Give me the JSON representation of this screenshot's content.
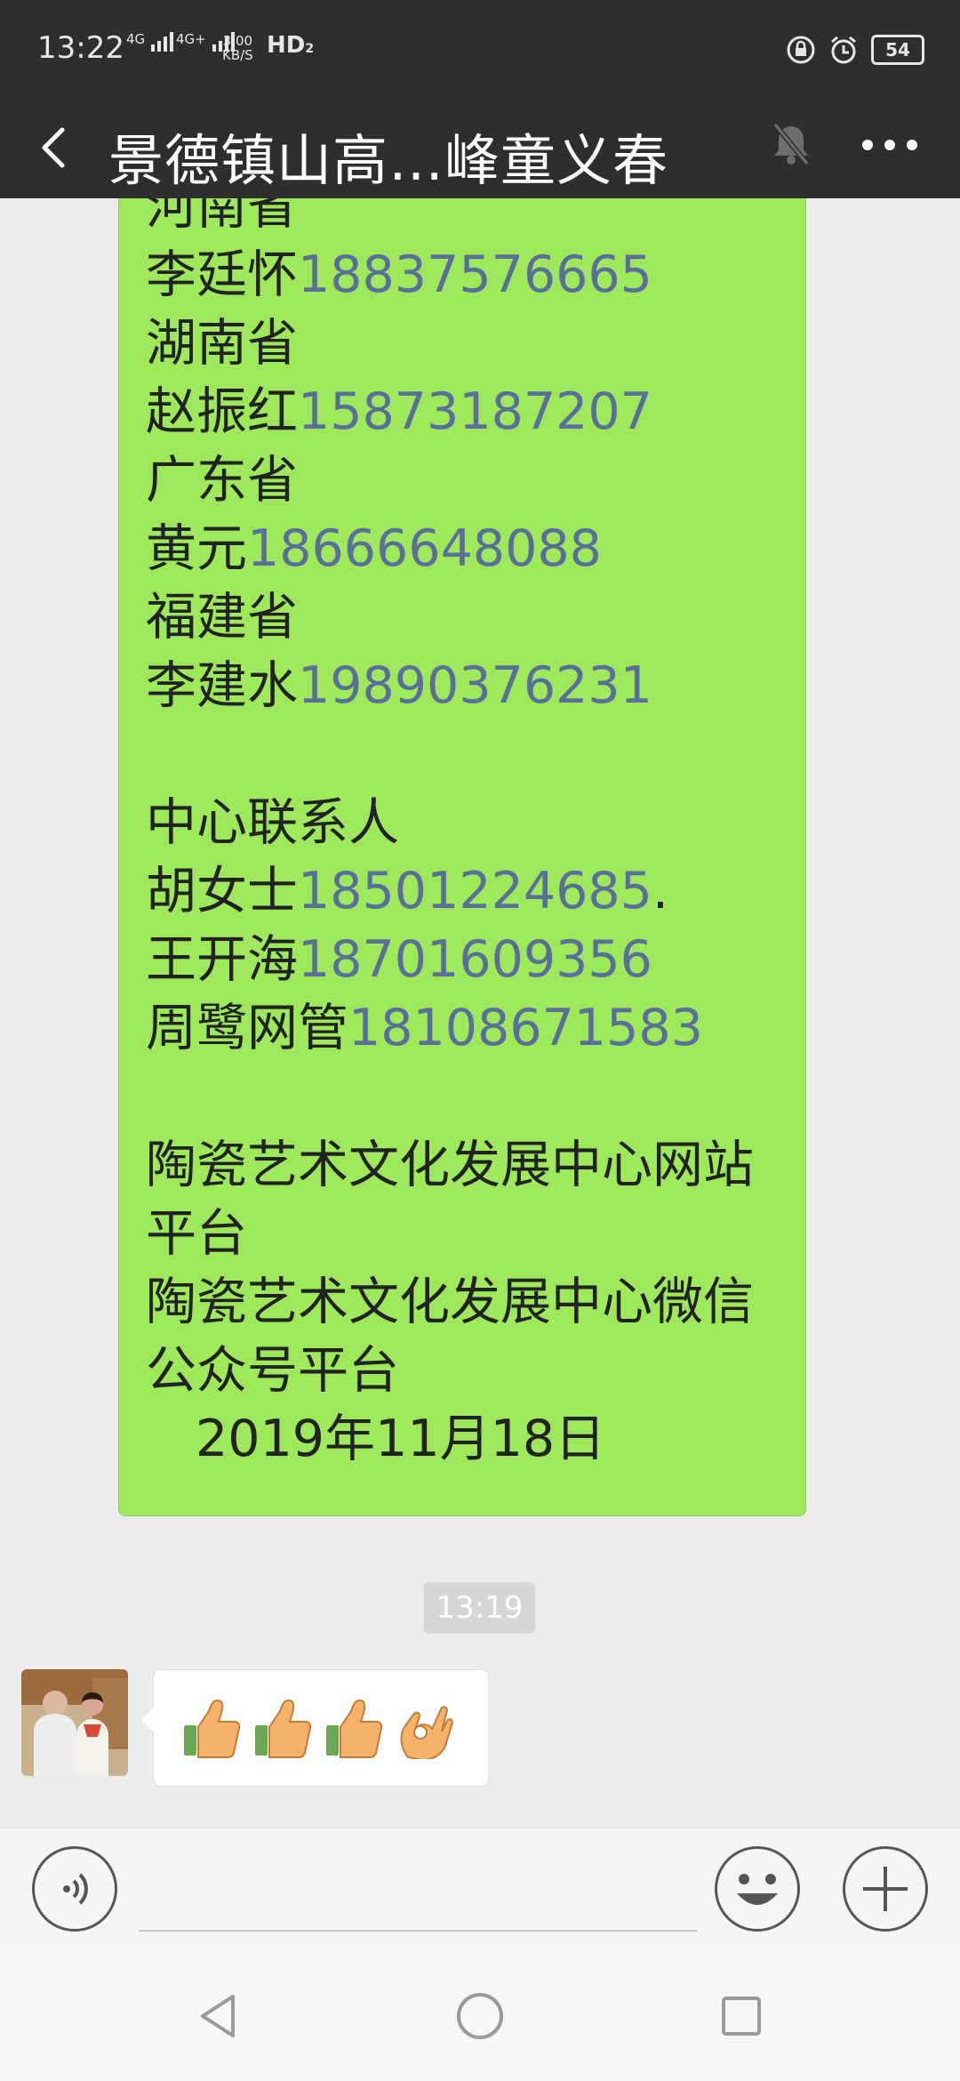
{
  "status_bar": {
    "time": "13:22",
    "network_1": "4G",
    "network_2": "4G+",
    "speed_value": "3.00",
    "speed_unit": "KB/S",
    "hd_label": "HD",
    "hd_sub": "2",
    "battery": "54"
  },
  "header": {
    "title": "景德镇山高…峰童义春",
    "back_icon": "chevron-left-icon",
    "mute_icon": "bell-muted-icon",
    "more_icon": "ellipsis-icon"
  },
  "message": {
    "lines": [
      {
        "text": "河南省",
        "phone": ""
      },
      {
        "text": "李廷怀",
        "phone": "18837576665"
      },
      {
        "text": "湖南省",
        "phone": ""
      },
      {
        "text": "赵振红",
        "phone": "15873187207"
      },
      {
        "text": "广东省",
        "phone": ""
      },
      {
        "text": "黄元",
        "phone": "18666648088"
      },
      {
        "text": "福建省",
        "phone": ""
      },
      {
        "text": "李建水",
        "phone": "19890376231"
      },
      {
        "text": "",
        "phone": ""
      },
      {
        "text": "中心联系人",
        "phone": ""
      },
      {
        "text": "胡女士",
        "phone": "18501224685",
        "suffix": "."
      },
      {
        "text": "王开海",
        "phone": "18701609356"
      },
      {
        "text": "周鹭网管",
        "phone": "18108671583"
      },
      {
        "text": "",
        "phone": ""
      },
      {
        "text": "陶瓷艺术文化发展中心网站",
        "phone": ""
      },
      {
        "text": "平台",
        "phone": ""
      },
      {
        "text": "陶瓷艺术文化发展中心微信",
        "phone": ""
      },
      {
        "text": "公众号平台",
        "phone": ""
      },
      {
        "text": "2019年11月18日",
        "phone": "",
        "indent": true
      }
    ]
  },
  "timestamp": "13:19",
  "reply": {
    "emojis": [
      "thumbs-up-icon",
      "thumbs-up-icon",
      "thumbs-up-icon",
      "ok-hand-icon"
    ]
  },
  "input_bar": {
    "voice_icon": "voice-icon",
    "emoji_icon": "smiley-icon",
    "plus_icon": "plus-icon",
    "text_value": ""
  },
  "colors": {
    "header_bg": "#2e2e2e",
    "chat_bg": "#ececec",
    "bubble_green": "#9ee85c",
    "phone_link": "#586f9a"
  }
}
